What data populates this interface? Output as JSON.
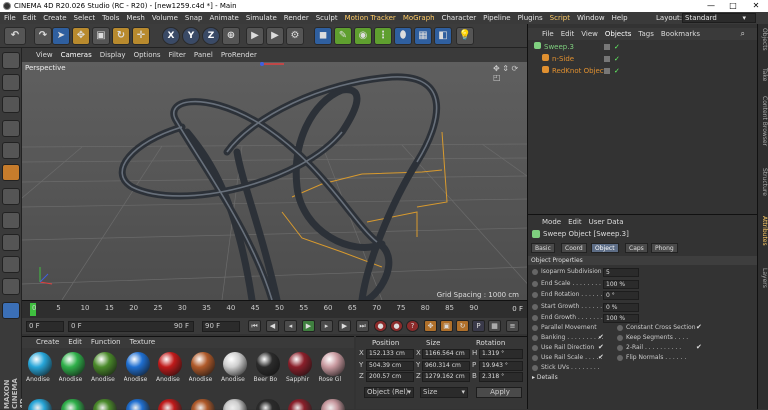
{
  "window": {
    "title": "CINEMA 4D R20.026 Studio (RC - R20) - [new1259.c4d *] - Main",
    "min": "—",
    "max": "□",
    "close": "✕"
  },
  "menu": [
    "File",
    "Edit",
    "Create",
    "Select",
    "Tools",
    "Mesh",
    "Volume",
    "Snap",
    "Animate",
    "Simulate",
    "Render",
    "Sculpt",
    "Motion Tracker",
    "MoGraph",
    "Character",
    "Pipeline",
    "Plugins",
    "Script",
    "Window",
    "Help"
  ],
  "layout": {
    "label": "Layout:",
    "value": "Standard"
  },
  "toolbar": {
    "x": "X",
    "y": "Y",
    "z": "Z"
  },
  "viewport": {
    "menu": [
      "View",
      "Cameras",
      "Display",
      "Options",
      "Filter",
      "Panel",
      "ProRender"
    ],
    "camera_label": "Perspective",
    "grid_spacing": "Grid Spacing : 1000 cm"
  },
  "timeline": {
    "ticks": [
      "0",
      "5",
      "10",
      "15",
      "20",
      "25",
      "30",
      "35",
      "40",
      "45",
      "50",
      "55",
      "60",
      "65",
      "70",
      "75",
      "80",
      "85",
      "90"
    ],
    "end_frame": "0 F"
  },
  "transport": {
    "current": "0 F",
    "start": "0 F",
    "range_end": "90 F",
    "end": "90 F"
  },
  "materials": {
    "menu": [
      "Create",
      "Edit",
      "Function",
      "Texture"
    ],
    "items": [
      {
        "name": "Anodise",
        "color": "#27a6d9"
      },
      {
        "name": "Anodise",
        "color": "#2fb04a"
      },
      {
        "name": "Anodise",
        "color": "#4a8a2a"
      },
      {
        "name": "Anodise",
        "color": "#1f6fd1"
      },
      {
        "name": "Anodise",
        "color": "#c01a1a"
      },
      {
        "name": "Anodise",
        "color": "#b05a2a"
      },
      {
        "name": "Anodise",
        "color": "#cfcfcf"
      },
      {
        "name": "Beer Bo",
        "color": "#2b2b2b"
      },
      {
        "name": "Sapphir",
        "color": "#8a1f2a"
      },
      {
        "name": "Rose Gl",
        "color": "#c99aa0"
      }
    ]
  },
  "coords": {
    "headers": {
      "position": "Position",
      "size": "Size",
      "rotation": "Rotation"
    },
    "rows": [
      {
        "axis": "X",
        "pos": "152.133 cm",
        "size": "1166.564 cm",
        "rl": "H",
        "rot": "1.319 °"
      },
      {
        "axis": "Y",
        "pos": "504.39 cm",
        "size": "960.314 cm",
        "rl": "P",
        "rot": "19.943 °"
      },
      {
        "axis": "Z",
        "pos": "200.57 cm",
        "size": "1279.162 cm",
        "rl": "B",
        "rot": "2.318 °"
      }
    ],
    "mode1": "Object (Rel)",
    "mode2": "Size",
    "apply": "Apply"
  },
  "objects": {
    "menu": [
      "File",
      "Edit",
      "View",
      "Objects",
      "Tags",
      "Bookmarks"
    ],
    "items": [
      {
        "name": "Sweep.3",
        "color": "#7fd07f"
      },
      {
        "name": "n-Side",
        "color": "#e09030"
      },
      {
        "name": "RedKnot Object",
        "color": "#e09030"
      }
    ]
  },
  "attributes": {
    "menu": [
      "Mode",
      "Edit",
      "User Data"
    ],
    "header": "Sweep Object [Sweep.3]",
    "tabs": [
      "Basic",
      "Coord",
      "Object",
      "Caps",
      "Phong"
    ],
    "section": "Object Properties",
    "fields": [
      {
        "label": "Isoparm Subdivision",
        "value": "5"
      },
      {
        "label": "End Scale . . . . . . . .",
        "value": "100 %"
      },
      {
        "label": "End Rotation . . . . . .",
        "value": "0 °"
      },
      {
        "label": "Start Growth . . . . . .",
        "value": "0 %"
      },
      {
        "label": "End Growth . . . . . . .",
        "value": "100 %"
      }
    ],
    "checks_left": [
      {
        "label": "Parallel Movement",
        "mark": ""
      },
      {
        "label": "Banking . . . . . . . . . .",
        "mark": "✔"
      },
      {
        "label": "Use Rail Direction",
        "mark": "✔"
      },
      {
        "label": "Use Rail Scale . . . . .",
        "mark": "✔"
      },
      {
        "label": "Stick UVs . . . . . . . .",
        "mark": ""
      }
    ],
    "checks_right": [
      {
        "label": "Constant Cross Section",
        "mark": "✔"
      },
      {
        "label": "Keep Segments . . . .",
        "mark": ""
      },
      {
        "label": "2-Rail . . . . . . . . . .",
        "mark": "✔"
      },
      {
        "label": "Flip Normals . . . . . .",
        "mark": ""
      }
    ],
    "details": "Details"
  },
  "right_strip": [
    {
      "label": "Objects",
      "active": false
    },
    {
      "label": "Take",
      "active": false
    },
    {
      "label": "Content Browser",
      "active": false
    },
    {
      "label": "Structure",
      "active": false
    },
    {
      "label": "Attributes",
      "active": true
    },
    {
      "label": "Layers",
      "active": false
    }
  ],
  "brand": {
    "line1": "MAXON",
    "line2": "CINEMA 4D"
  }
}
